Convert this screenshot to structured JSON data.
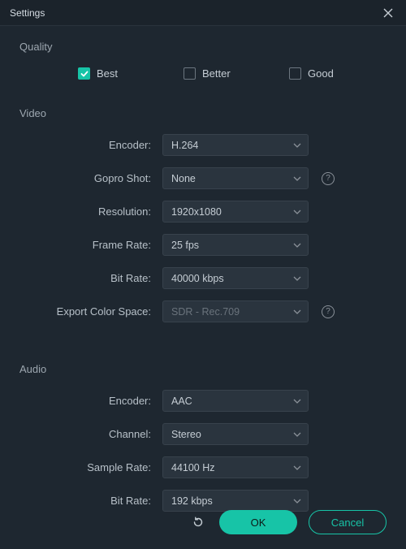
{
  "window": {
    "title": "Settings"
  },
  "quality": {
    "label": "Quality",
    "options": {
      "best": "Best",
      "better": "Better",
      "good": "Good"
    },
    "selected": "best"
  },
  "video": {
    "label": "Video",
    "encoder": {
      "label": "Encoder:",
      "value": "H.264"
    },
    "goproShot": {
      "label": "Gopro Shot:",
      "value": "None"
    },
    "resolution": {
      "label": "Resolution:",
      "value": "1920x1080"
    },
    "frameRate": {
      "label": "Frame Rate:",
      "value": "25 fps"
    },
    "bitRate": {
      "label": "Bit Rate:",
      "value": "40000 kbps"
    },
    "colorSpace": {
      "label": "Export Color Space:",
      "value": "SDR - Rec.709"
    }
  },
  "audio": {
    "label": "Audio",
    "encoder": {
      "label": "Encoder:",
      "value": "AAC"
    },
    "channel": {
      "label": "Channel:",
      "value": "Stereo"
    },
    "sampleRate": {
      "label": "Sample Rate:",
      "value": "44100 Hz"
    },
    "bitRate": {
      "label": "Bit Rate:",
      "value": "192 kbps"
    }
  },
  "footer": {
    "ok": "OK",
    "cancel": "Cancel"
  }
}
